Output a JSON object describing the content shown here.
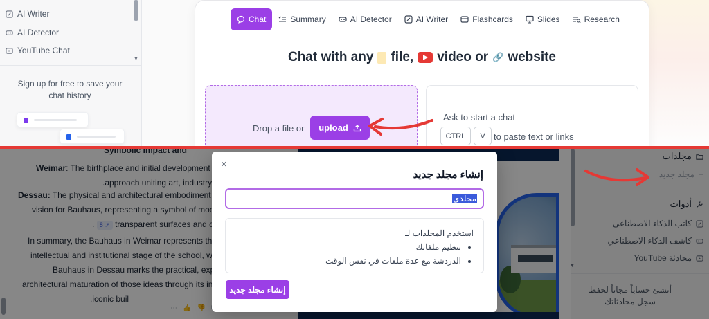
{
  "top_sidebar": {
    "items": [
      {
        "label": "AI Writer",
        "icon": "edit-icon"
      },
      {
        "label": "AI Detector",
        "icon": "detector-icon"
      },
      {
        "label": "YouTube Chat",
        "icon": "youtube-icon"
      }
    ],
    "signup_text": "Sign up for free to save your chat history"
  },
  "tabs": [
    {
      "label": "Chat",
      "icon": "chat-bubble-icon",
      "active": true
    },
    {
      "label": "Summary",
      "icon": "list-check-icon",
      "active": false
    },
    {
      "label": "AI Detector",
      "icon": "detector-icon",
      "active": false
    },
    {
      "label": "AI Writer",
      "icon": "edit-icon",
      "active": false
    },
    {
      "label": "Flashcards",
      "icon": "cards-icon",
      "active": false
    },
    {
      "label": "Slides",
      "icon": "presentation-icon",
      "active": false
    },
    {
      "label": "Research",
      "icon": "research-icon",
      "active": false
    }
  ],
  "headline": {
    "part1": "Chat with any",
    "part2": "file,",
    "part3": "video or",
    "part4": "website"
  },
  "dropzone": {
    "text": "Drop a file or",
    "upload_label": "upload"
  },
  "ask": {
    "text": "Ask to start a chat",
    "key1": "CTRL",
    "key2": "V",
    "paste_text": "to paste text or links"
  },
  "document": {
    "line0": "Symbolic Impact and",
    "weimar_label": "Weimar",
    "weimar_line1": ": The birthplace and initial development o",
    "weimar_line2": ".approach uniting art, industry,",
    "dessau_label": "Dessau:",
    "dessau_line1": " The physical and architectural embodiment of",
    "dessau_line2": "vision for Bauhaus, representing a symbol of modernit",
    "dessau_line3_prefix": ".",
    "dessau_chip": "8 ↗",
    "dessau_line3_suffix": "transparent surfaces and ope",
    "summary_line1": "In summary, the Bauhaus in Weimar represents the fo",
    "summary_line2": "intellectual and institutional stage of the school, w",
    "summary_line3": "Bauhaus in Dessau marks the practical, experi",
    "summary_line4": "architectural maturation of those ideas through its inn",
    "summary_line5": ".iconic buil"
  },
  "right_sidebar": {
    "folders_heading": "مجلدات",
    "new_folder": "مجلد جديد",
    "tools_heading": "أدوات",
    "tools": [
      {
        "label": "كاتب الذكاء الاصطناعي",
        "icon": "edit-icon"
      },
      {
        "label": "كاشف الذكاء الاصطناعي",
        "icon": "detector-icon"
      },
      {
        "label": "محادثة YouTube",
        "icon": "youtube-icon"
      }
    ],
    "signup_text": "أنشئ حساباً مجاناً لحفظ سجل محادثاتك"
  },
  "modal": {
    "title": "إنشاء مجلد جديد",
    "close": "×",
    "input_value": "مجلدي",
    "info_heading": "استخدم المجلدات لـ",
    "info_items": [
      "تنظيم ملفاتك",
      "الدردشة مع عدة ملفات في نفس الوقت"
    ],
    "create_label": "إنشاء مجلد جديد"
  },
  "colors": {
    "accent": "#9b3fe6",
    "divider_red": "#e53935"
  }
}
